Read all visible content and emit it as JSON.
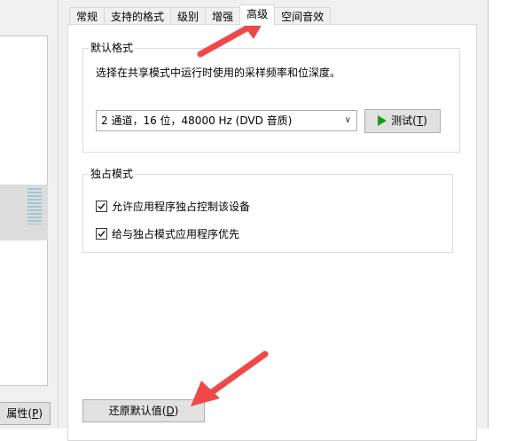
{
  "background_window": {
    "properties_button_label": "属性(",
    "properties_button_mnemonic": "P",
    "properties_button_suffix": ")"
  },
  "tabs": [
    {
      "label": "常规"
    },
    {
      "label": "支持的格式"
    },
    {
      "label": "级别"
    },
    {
      "label": "增强"
    },
    {
      "label": "高级",
      "active": true
    },
    {
      "label": "空间音效"
    }
  ],
  "default_format": {
    "title": "默认格式",
    "description": "选择在共享模式中运行时使用的采样频率和位深度。",
    "selected_format": "2 通道，16 位，48000 Hz (DVD 音质)",
    "test_button_label": "测试(",
    "test_button_mnemonic": "T",
    "test_button_suffix": ")"
  },
  "exclusive_mode": {
    "title": "独占模式",
    "options": [
      {
        "label": "允许应用程序独占控制该设备",
        "checked": true
      },
      {
        "label": "给与独占模式应用程序优先",
        "checked": true
      }
    ]
  },
  "footer": {
    "restore_button_label": "还原默认值(",
    "restore_button_mnemonic": "D",
    "restore_button_suffix": ")"
  },
  "colors": {
    "dialog_bg": "#f0f0f0",
    "page_bg": "#ffffff",
    "button_bg": "#e1e1e1",
    "play_icon": "#1a9a1a",
    "annotation_arrow": "#f04848"
  },
  "icons": {
    "test_button": "play-icon",
    "combo": "chevron-down-icon",
    "checkbox": "checkmark-icon",
    "annotations": "arrow-icon"
  }
}
